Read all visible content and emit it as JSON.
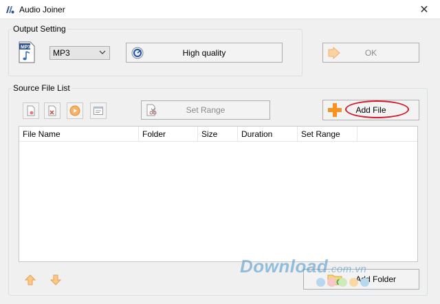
{
  "window": {
    "title": "Audio Joiner",
    "close_glyph": "✕"
  },
  "output_setting": {
    "legend": "Output Setting",
    "format_icon": "mp3-file-icon",
    "format_icon_text": "MP3",
    "format_selected": "MP3",
    "quality_label": "High quality",
    "ok_label": "OK"
  },
  "source_file_list": {
    "legend": "Source File List",
    "toolbar_icons": [
      "remove-file-icon",
      "clear-list-icon",
      "play-icon",
      "properties-icon"
    ],
    "set_range_label": "Set Range",
    "add_file_label": "Add File",
    "columns": [
      "File Name",
      "Folder",
      "Size",
      "Duration",
      "Set Range"
    ],
    "rows": [],
    "move_up_icon": "arrow-up-icon",
    "move_down_icon": "arrow-down-icon",
    "add_folder_label": "Add Folder"
  },
  "watermark": {
    "text": "Download",
    "suffix": ".com.vn"
  },
  "colors": {
    "highlight_ring": "#d41b2c",
    "watermark": "#4394c8",
    "add_orange": "#f7931e"
  }
}
